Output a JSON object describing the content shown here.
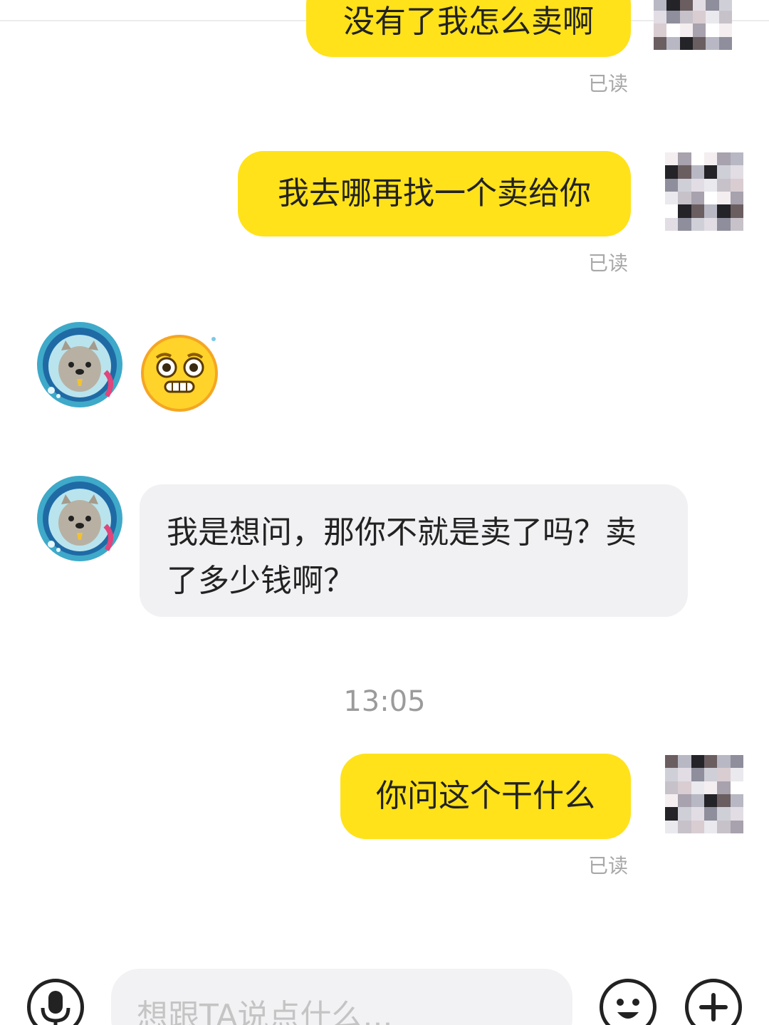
{
  "colors": {
    "my_bubble": "#ffe21a",
    "their_bubble": "#f1f1f3",
    "text": "#222222",
    "meta_text": "#a8a8a8"
  },
  "messages": [
    {
      "sender": "me",
      "text": "没有了我怎么卖啊",
      "status": "已读"
    },
    {
      "sender": "me",
      "text": "我去哪再找一个卖给你",
      "status": "已读"
    },
    {
      "sender": "them",
      "type": "sticker",
      "icon": "anxious-face-emoji"
    },
    {
      "sender": "them",
      "text": "我是想问，那你不就是卖了吗？卖了多少钱啊？"
    },
    {
      "sender": "me",
      "text": "你问这个干什么",
      "status": "已读"
    }
  ],
  "timestamp": "13:05",
  "input_bar": {
    "placeholder": "想跟TA说点什么...",
    "value": "",
    "voice_icon": "microphone-icon",
    "emoji_icon": "smiley-icon",
    "more_icon": "plus-icon"
  }
}
